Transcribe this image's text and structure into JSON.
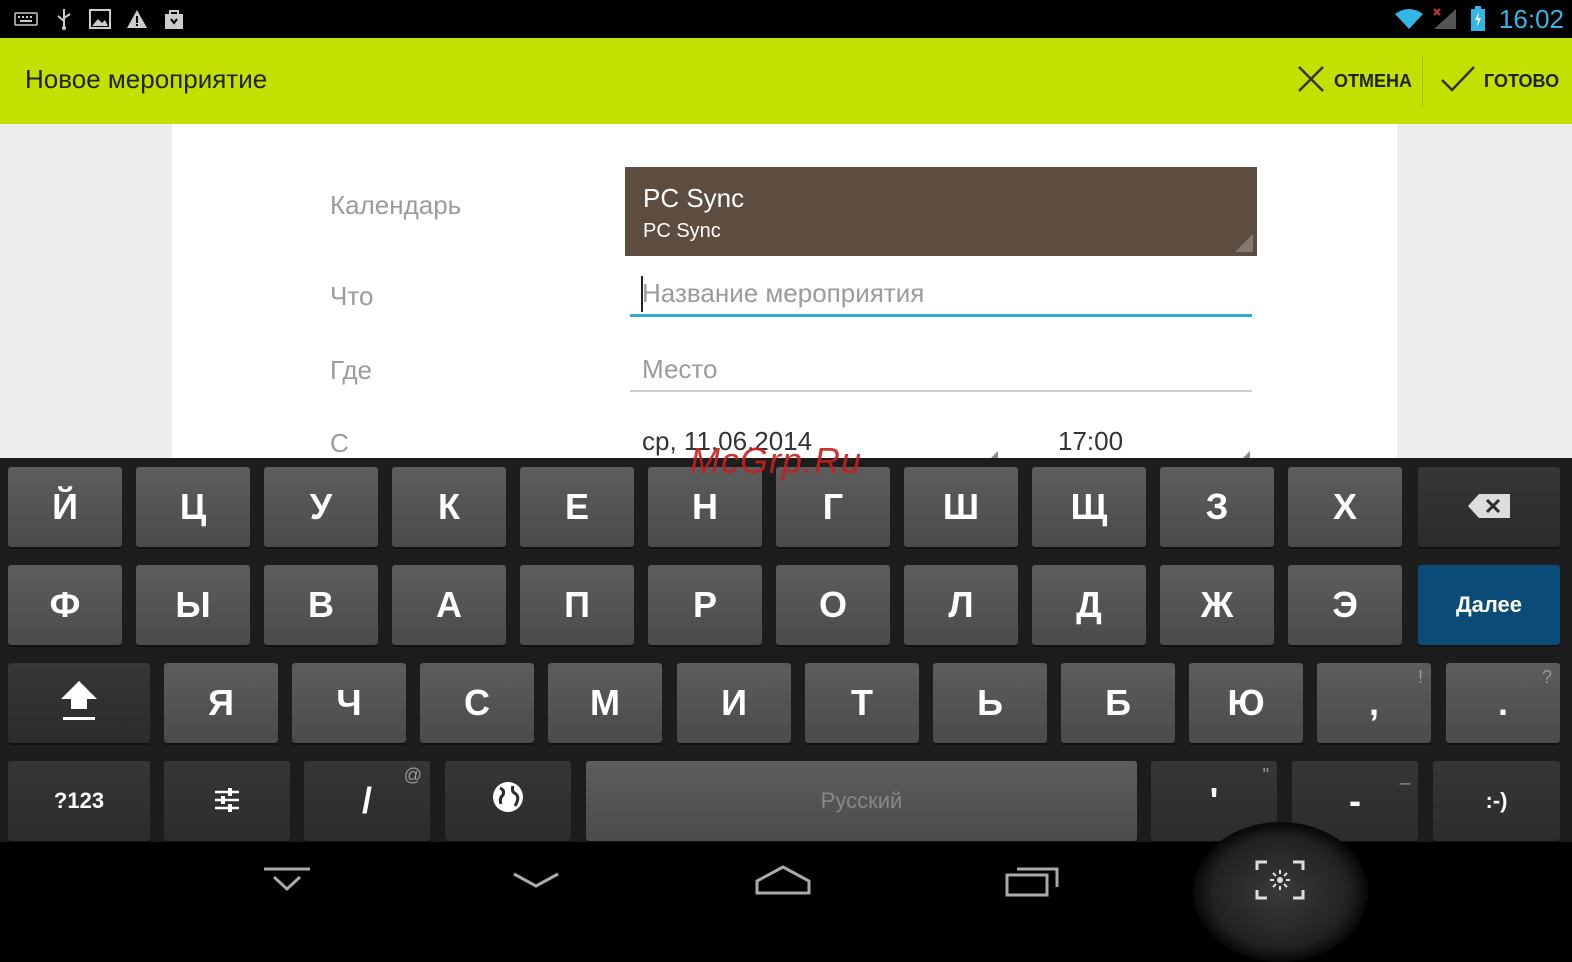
{
  "status_bar": {
    "time": "16:02",
    "left_icons": [
      "keyboard-icon",
      "usb-icon",
      "image-icon",
      "warning-icon",
      "shopping-bag-icon"
    ],
    "right_icons": [
      "wifi-icon",
      "signal-icon",
      "battery-icon"
    ]
  },
  "action_bar": {
    "title": "Новое мероприятие",
    "cancel_label": "ОТМЕНА",
    "done_label": "ГОТОВО"
  },
  "form": {
    "calendar_label": "Календарь",
    "calendar_name": "PC Sync",
    "calendar_account": "PC Sync",
    "what_label": "Что",
    "what_placeholder": "Название мероприятия",
    "what_value": "",
    "where_label": "Где",
    "where_placeholder": "Место",
    "where_value": "",
    "from_label": "С",
    "from_date": "ср, 11.06.2014",
    "from_time": "17:00"
  },
  "watermark": "McGrp.Ru",
  "keyboard": {
    "row1": [
      "Й",
      "Ц",
      "У",
      "К",
      "Е",
      "Н",
      "Г",
      "Ш",
      "Щ",
      "З",
      "Х"
    ],
    "row2": [
      "Ф",
      "Ы",
      "В",
      "А",
      "П",
      "Р",
      "О",
      "Л",
      "Д",
      "Ж",
      "Э"
    ],
    "row3": [
      "Я",
      "Ч",
      "С",
      "М",
      "И",
      "Т",
      "Ь",
      "Б",
      "Ю"
    ],
    "comma": ",",
    "comma_hint": "!",
    "period": ".",
    "period_hint": "?",
    "next_label": "Далее",
    "symbols_label": "?123",
    "slash": "/",
    "slash_hint": "@",
    "space_label": "Русский",
    "apostrophe": "'",
    "apostrophe_hint": "\"",
    "dash": "-",
    "dash_hint": "_",
    "smiley": ":-)"
  },
  "colors": {
    "action_bar": "#c3e100",
    "calendar_bg": "#5d4d41",
    "focus_underline": "#33a9d6",
    "next_key": "#0b4b78",
    "clock": "#33b5e5"
  }
}
